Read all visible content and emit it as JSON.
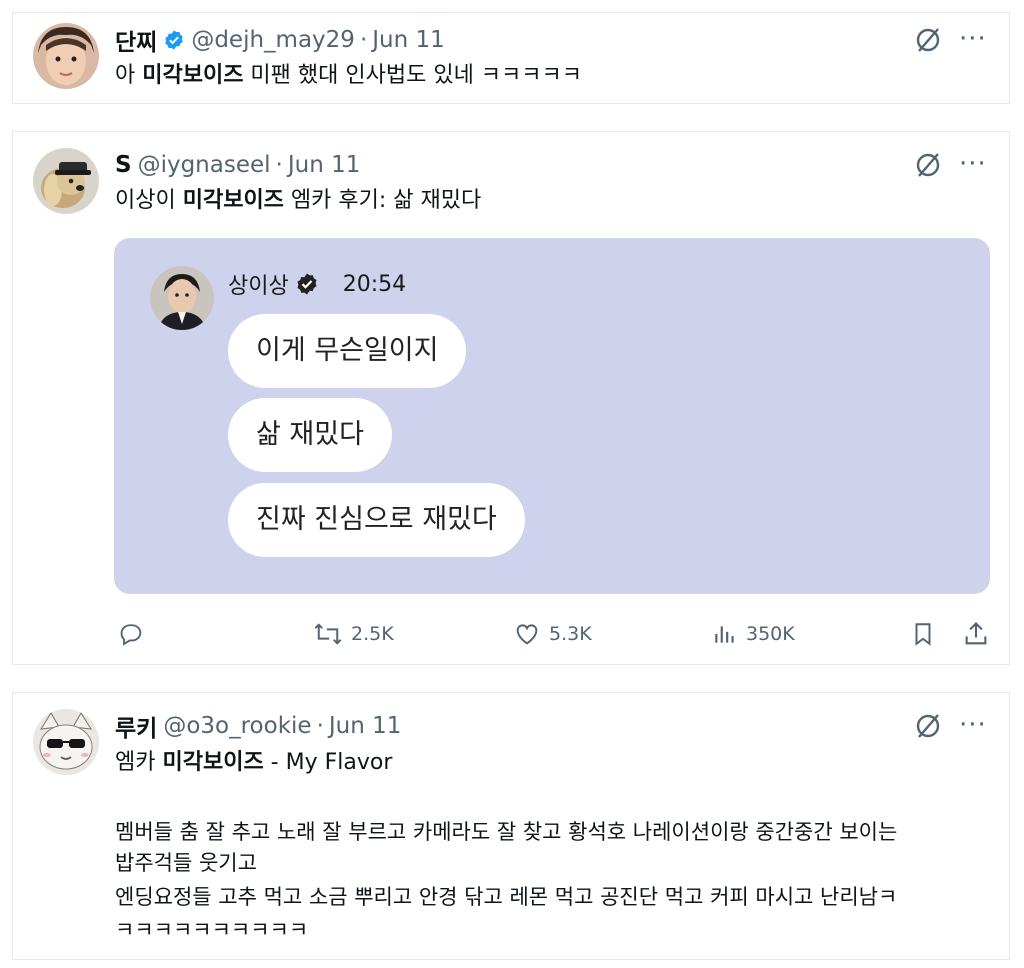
{
  "tweets": [
    {
      "name": "단찌",
      "handle": "@dejh_may29",
      "dot": "·",
      "date": "Jun 11",
      "text_pre": "아 ",
      "text_bold": "미각보이즈",
      "text_post": " 미팬 했대 인사법도 있네 ㅋㅋㅋㅋㅋ"
    },
    {
      "name": "S",
      "handle": "@iygnaseel",
      "dot": "·",
      "date": "Jun 11",
      "text_pre": "이상이 ",
      "text_bold": "미각보이즈",
      "text_post": " 엠카 후기: 삶 재밌다",
      "embed": {
        "name": "상이상",
        "time": "20:54",
        "bubbles": [
          "이게 무슨일이지",
          "삶 재밌다",
          "진짜 진심으로 재밌다"
        ]
      },
      "actions": {
        "retweets": "2.5K",
        "likes": "5.3K",
        "views": "350K"
      }
    },
    {
      "name": "루키",
      "handle": "@o3o_rookie",
      "dot": "·",
      "date": "Jun 11",
      "text_pre": "엠카 ",
      "text_bold": "미각보이즈",
      "text_post": " - My Flavor",
      "body_lines": [
        "멤버들 춤 잘 추고 노래 잘 부르고 카메라도 잘 찾고 황석호 나레이션이랑 중간중간 보이는",
        "밥주걱들 웃기고",
        "엔딩요정들 고추 먹고 소금 뿌리고 안경 닦고 레몬 먹고 공진단 먹고 커피 마시고 난리남ㅋ",
        "ㅋㅋㅋㅋㅋㅋㅋㅋㅋㅋ"
      ]
    }
  ],
  "icons": {
    "verified": "verified-badge-icon",
    "grok": "grok-icon",
    "more": "more-options-icon",
    "reply": "reply-icon",
    "retweet": "retweet-icon",
    "like": "like-icon",
    "views": "views-icon",
    "bookmark": "bookmark-icon",
    "share": "share-icon"
  },
  "more_glyph": "···",
  "colors": {
    "verified": "#1d9bf0",
    "embed_bg": "#cfd2ec",
    "muted": "#536471"
  }
}
